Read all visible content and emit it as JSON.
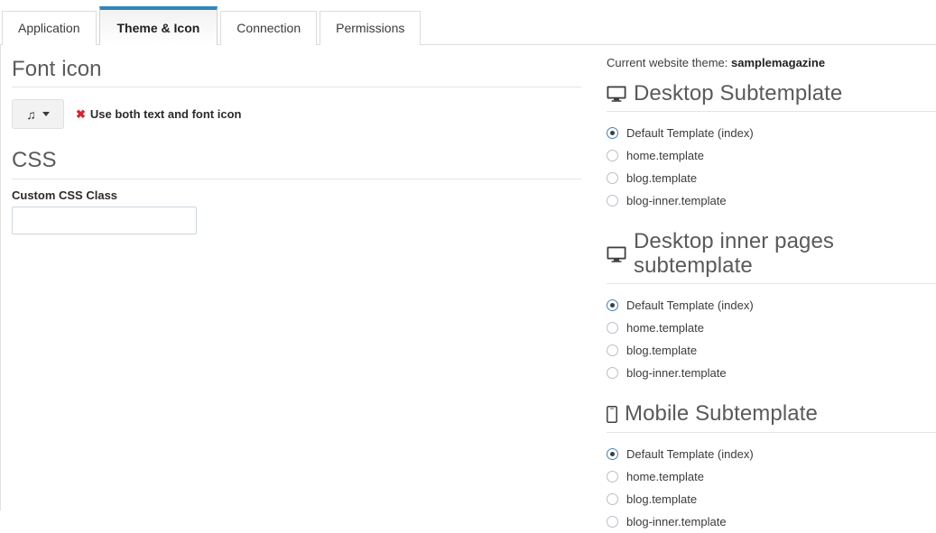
{
  "tabs": [
    {
      "label": "Application",
      "active": false
    },
    {
      "label": "Theme & Icon",
      "active": true
    },
    {
      "label": "Connection",
      "active": false
    },
    {
      "label": "Permissions",
      "active": false
    }
  ],
  "left": {
    "font_icon_heading": "Font icon",
    "icon_picker": {
      "glyph": "music-note-icon",
      "glyph_char": "♫",
      "caret": "chevron-down-icon"
    },
    "use_both_mark": "✖",
    "use_both_label": "Use both text and font icon",
    "css_heading": "CSS",
    "custom_css_label": "Custom CSS Class",
    "custom_css_value": "",
    "custom_css_placeholder": ""
  },
  "right": {
    "current_theme_prefix": "Current website theme:",
    "current_theme_name": "samplemagazine",
    "sections": [
      {
        "icon": "desktop-monitor-icon",
        "title": "Desktop Subtemplate",
        "options": [
          {
            "label": "Default Template (index)",
            "selected": true
          },
          {
            "label": "home.template",
            "selected": false
          },
          {
            "label": "blog.template",
            "selected": false
          },
          {
            "label": "blog-inner.template",
            "selected": false
          }
        ]
      },
      {
        "icon": "desktop-monitor-icon",
        "title": "Desktop inner pages subtemplate",
        "options": [
          {
            "label": "Default Template (index)",
            "selected": true
          },
          {
            "label": "home.template",
            "selected": false
          },
          {
            "label": "blog.template",
            "selected": false
          },
          {
            "label": "blog-inner.template",
            "selected": false
          }
        ]
      },
      {
        "icon": "mobile-phone-icon",
        "title": "Mobile Subtemplate",
        "options": [
          {
            "label": "Default Template (index)",
            "selected": true
          },
          {
            "label": "home.template",
            "selected": false
          },
          {
            "label": "blog.template",
            "selected": false
          },
          {
            "label": "blog-inner.template",
            "selected": false
          }
        ]
      }
    ]
  },
  "colors": {
    "active_tab_accent": "#2e86b9",
    "x_mark_red": "#d9232d",
    "radio_selected_border": "#4a7fb5",
    "heading_gray": "#5a5a5a"
  }
}
